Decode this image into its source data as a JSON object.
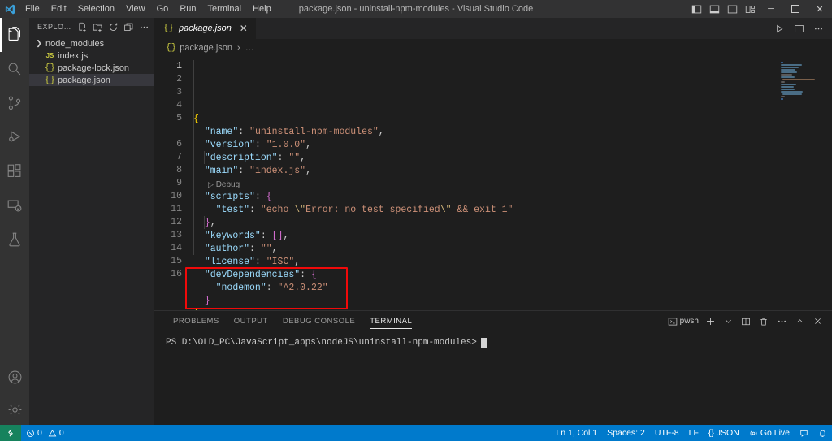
{
  "titlebar": {
    "title": "package.json - uninstall-npm-modules - Visual Studio Code",
    "logo_icon": "vscode-logo-icon",
    "menus": [
      {
        "label": "File"
      },
      {
        "label": "Edit"
      },
      {
        "label": "Selection"
      },
      {
        "label": "View"
      },
      {
        "label": "Go"
      },
      {
        "label": "Run"
      },
      {
        "label": "Terminal"
      },
      {
        "label": "Help"
      }
    ],
    "layout_controls": [
      {
        "name": "toggle-primary-sidebar-icon",
        "title": "Toggle Primary Side Bar"
      },
      {
        "name": "toggle-panel-icon",
        "title": "Toggle Panel"
      },
      {
        "name": "toggle-secondary-sidebar-icon",
        "title": "Toggle Secondary Side Bar"
      },
      {
        "name": "customize-layout-icon",
        "title": "Customize Layout"
      }
    ],
    "window_controls": [
      {
        "name": "minimize-button",
        "glyph": "─"
      },
      {
        "name": "maximize-button",
        "glyph": "☐"
      },
      {
        "name": "close-button",
        "glyph": "✕"
      }
    ]
  },
  "activitybar": {
    "items": [
      {
        "name": "activity-explorer",
        "label": "Explorer",
        "active": true
      },
      {
        "name": "activity-search",
        "label": "Search",
        "active": false
      },
      {
        "name": "activity-source-control",
        "label": "Source Control",
        "active": false
      },
      {
        "name": "activity-run-debug",
        "label": "Run and Debug",
        "active": false
      },
      {
        "name": "activity-extensions",
        "label": "Extensions",
        "active": false
      },
      {
        "name": "activity-remote-explorer",
        "label": "Remote Explorer",
        "active": false
      },
      {
        "name": "activity-testing",
        "label": "Testing",
        "active": false
      }
    ],
    "bottom": [
      {
        "name": "activity-accounts",
        "label": "Accounts"
      },
      {
        "name": "activity-settings",
        "label": "Manage"
      }
    ]
  },
  "sidebar": {
    "header_title": "EXPLORER: U...",
    "actions": [
      {
        "name": "new-file-icon",
        "title": "New File"
      },
      {
        "name": "new-folder-icon",
        "title": "New Folder"
      },
      {
        "name": "refresh-explorer-icon",
        "title": "Refresh Explorer"
      },
      {
        "name": "collapse-folders-icon",
        "title": "Collapse Folders in Explorer"
      },
      {
        "name": "explorer-more-actions-icon",
        "title": "Views and More Actions..."
      }
    ],
    "tree": [
      {
        "name": "node_modules",
        "kind": "folder",
        "icon": "chevron-right-icon",
        "selected": false
      },
      {
        "name": "index.js",
        "kind": "js",
        "icon": "js-file-icon",
        "selected": false
      },
      {
        "name": "package-lock.json",
        "kind": "json",
        "icon": "json-file-icon",
        "selected": false
      },
      {
        "name": "package.json",
        "kind": "json",
        "icon": "json-file-icon",
        "selected": true
      }
    ]
  },
  "editor": {
    "tab": {
      "icon": "json-file-icon",
      "label": "package.json",
      "close_glyph": "✕",
      "dirty": false
    },
    "actions": [
      {
        "name": "run-code-icon",
        "title": "Run Code"
      },
      {
        "name": "split-editor-icon",
        "title": "Split Editor Right"
      },
      {
        "name": "editor-more-actions-icon",
        "title": "More Actions..."
      }
    ],
    "breadcrumb": {
      "file_icon": "json-file-icon",
      "file": "package.json",
      "separator": "›",
      "trail": "…"
    },
    "codelens": {
      "label": "Debug",
      "glyph": "▷",
      "after_line": 5
    },
    "lines": [
      {
        "n": 1,
        "active": true,
        "tokens": [
          {
            "t": "{",
            "c": "b1"
          }
        ]
      },
      {
        "n": 2,
        "active": false,
        "tokens": [
          {
            "t": "  ",
            "c": "p"
          },
          {
            "t": "\"name\"",
            "c": "k"
          },
          {
            "t": ": ",
            "c": "p"
          },
          {
            "t": "\"uninstall-npm-modules\"",
            "c": "s"
          },
          {
            "t": ",",
            "c": "p"
          }
        ]
      },
      {
        "n": 3,
        "active": false,
        "tokens": [
          {
            "t": "  ",
            "c": "p"
          },
          {
            "t": "\"version\"",
            "c": "k"
          },
          {
            "t": ": ",
            "c": "p"
          },
          {
            "t": "\"1.0.0\"",
            "c": "s"
          },
          {
            "t": ",",
            "c": "p"
          }
        ]
      },
      {
        "n": 4,
        "active": false,
        "tokens": [
          {
            "t": "  ",
            "c": "p"
          },
          {
            "t": "\"description\"",
            "c": "k"
          },
          {
            "t": ": ",
            "c": "p"
          },
          {
            "t": "\"\"",
            "c": "s"
          },
          {
            "t": ",",
            "c": "p"
          }
        ]
      },
      {
        "n": 5,
        "active": false,
        "tokens": [
          {
            "t": "  ",
            "c": "p"
          },
          {
            "t": "\"main\"",
            "c": "k"
          },
          {
            "t": ": ",
            "c": "p"
          },
          {
            "t": "\"index.js\"",
            "c": "s"
          },
          {
            "t": ",",
            "c": "p"
          }
        ]
      },
      {
        "n": 6,
        "active": false,
        "tokens": [
          {
            "t": "  ",
            "c": "p"
          },
          {
            "t": "\"scripts\"",
            "c": "k"
          },
          {
            "t": ": ",
            "c": "p"
          },
          {
            "t": "{",
            "c": "b2"
          }
        ]
      },
      {
        "n": 7,
        "active": false,
        "tokens": [
          {
            "t": "    ",
            "c": "p"
          },
          {
            "t": "\"test\"",
            "c": "k"
          },
          {
            "t": ": ",
            "c": "p"
          },
          {
            "t": "\"echo ",
            "c": "s"
          },
          {
            "t": "\\\"",
            "c": "esc"
          },
          {
            "t": "Error: no test specified",
            "c": "s"
          },
          {
            "t": "\\\"",
            "c": "esc"
          },
          {
            "t": " && exit 1\"",
            "c": "s"
          }
        ]
      },
      {
        "n": 8,
        "active": false,
        "tokens": [
          {
            "t": "  ",
            "c": "p"
          },
          {
            "t": "}",
            "c": "b2"
          },
          {
            "t": ",",
            "c": "p"
          }
        ]
      },
      {
        "n": 9,
        "active": false,
        "tokens": [
          {
            "t": "  ",
            "c": "p"
          },
          {
            "t": "\"keywords\"",
            "c": "k"
          },
          {
            "t": ": ",
            "c": "p"
          },
          {
            "t": "[]",
            "c": "b2"
          },
          {
            "t": ",",
            "c": "p"
          }
        ]
      },
      {
        "n": 10,
        "active": false,
        "tokens": [
          {
            "t": "  ",
            "c": "p"
          },
          {
            "t": "\"author\"",
            "c": "k"
          },
          {
            "t": ": ",
            "c": "p"
          },
          {
            "t": "\"\"",
            "c": "s"
          },
          {
            "t": ",",
            "c": "p"
          }
        ]
      },
      {
        "n": 11,
        "active": false,
        "tokens": [
          {
            "t": "  ",
            "c": "p"
          },
          {
            "t": "\"license\"",
            "c": "k"
          },
          {
            "t": ": ",
            "c": "p"
          },
          {
            "t": "\"ISC\"",
            "c": "s"
          },
          {
            "t": ",",
            "c": "p"
          }
        ]
      },
      {
        "n": 12,
        "active": false,
        "tokens": [
          {
            "t": "  ",
            "c": "p"
          },
          {
            "t": "\"devDependencies\"",
            "c": "k"
          },
          {
            "t": ": ",
            "c": "p"
          },
          {
            "t": "{",
            "c": "b2"
          }
        ]
      },
      {
        "n": 13,
        "active": false,
        "tokens": [
          {
            "t": "    ",
            "c": "p"
          },
          {
            "t": "\"nodemon\"",
            "c": "k"
          },
          {
            "t": ": ",
            "c": "p"
          },
          {
            "t": "\"^2.0.22\"",
            "c": "s"
          }
        ]
      },
      {
        "n": 14,
        "active": false,
        "tokens": [
          {
            "t": "  ",
            "c": "p"
          },
          {
            "t": "}",
            "c": "b2"
          }
        ]
      },
      {
        "n": 15,
        "active": false,
        "tokens": [
          {
            "t": "}",
            "c": "b1"
          }
        ]
      },
      {
        "n": 16,
        "active": false,
        "tokens": []
      }
    ],
    "annotation": {
      "name": "red-highlight-box",
      "color": "#f10a0a",
      "covers_lines": [
        12,
        13,
        14
      ]
    }
  },
  "panel": {
    "tabs": [
      {
        "label": "PROBLEMS",
        "active": false
      },
      {
        "label": "OUTPUT",
        "active": false
      },
      {
        "label": "DEBUG CONSOLE",
        "active": false
      },
      {
        "label": "TERMINAL",
        "active": true
      }
    ],
    "actions": [
      {
        "name": "terminal-profile-button",
        "label": "pwsh",
        "icon": "terminal-icon"
      },
      {
        "name": "new-terminal-button",
        "label": "+",
        "icon": "plus-icon"
      },
      {
        "name": "terminal-profile-dropdown",
        "label": "⌄",
        "icon": "chevron-down-icon"
      },
      {
        "name": "split-terminal-button",
        "label": "",
        "icon": "split-icon"
      },
      {
        "name": "kill-terminal-button",
        "label": "",
        "icon": "trash-icon"
      },
      {
        "name": "panel-more-actions-button",
        "label": "···",
        "icon": "ellipsis-icon"
      },
      {
        "name": "maximize-panel-button",
        "label": "⌃",
        "icon": "chevron-up-icon"
      },
      {
        "name": "close-panel-button",
        "label": "✕",
        "icon": "close-icon"
      }
    ],
    "terminal": {
      "prompt": "PS D:\\OLD_PC\\JavaScript_apps\\nodeJS\\uninstall-npm-modules>",
      "input": ""
    }
  },
  "statusbar": {
    "remote_icon": "remote-window-icon",
    "left": [
      {
        "name": "status-problems",
        "icon": "error-icon",
        "errors": "0",
        "warn_icon": "warning-icon",
        "warnings": "0"
      }
    ],
    "right": [
      {
        "name": "status-cursor-position",
        "label": "Ln 1, Col 1"
      },
      {
        "name": "status-indentation",
        "label": "Spaces: 2"
      },
      {
        "name": "status-encoding",
        "label": "UTF-8"
      },
      {
        "name": "status-eol",
        "label": "LF"
      },
      {
        "name": "status-language-mode",
        "label": "{} JSON"
      },
      {
        "name": "status-go-live",
        "label": "Go Live",
        "icon": "broadcast-icon"
      },
      {
        "name": "status-feedback",
        "label": "",
        "icon": "feedback-icon"
      },
      {
        "name": "status-notifications",
        "label": "",
        "icon": "bell-icon"
      }
    ]
  },
  "colors": {
    "accent": "#007acc",
    "remote": "#16825d",
    "annotation": "#f10a0a",
    "editor_bg": "#1e1e1e",
    "sidebar_bg": "#252526",
    "activitybar_bg": "#333333"
  }
}
